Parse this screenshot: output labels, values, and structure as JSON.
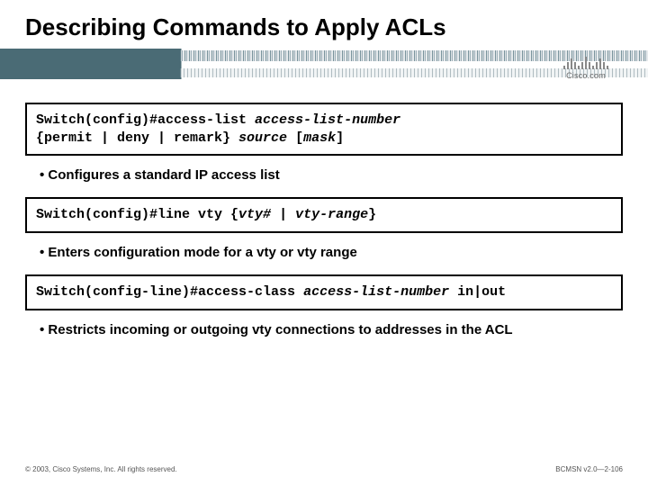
{
  "title": "Describing Commands to Apply ACLs",
  "logo_text": "Cisco.com",
  "sections": [
    {
      "cmd_plain1": "Switch(config)#access-list ",
      "cmd_italic1": "access-list-number",
      "cmd_plain2": "\n{permit | deny | remark} ",
      "cmd_italic2": "source",
      "cmd_plain3": " [",
      "cmd_italic3": "mask",
      "cmd_plain4": "]",
      "bullet": "Configures a standard IP access list"
    },
    {
      "cmd_plain1": "Switch(config)#line vty {",
      "cmd_italic1": "vty#",
      "cmd_plain2": " | ",
      "cmd_italic2": "vty-range",
      "cmd_plain3": "}",
      "cmd_italic3": "",
      "cmd_plain4": "",
      "bullet": "Enters configuration mode for a vty or vty range"
    },
    {
      "cmd_plain1": "Switch(config-line)#access-class ",
      "cmd_italic1": "access-list-number",
      "cmd_plain2": " in|out",
      "cmd_italic2": "",
      "cmd_plain3": "",
      "cmd_italic3": "",
      "cmd_plain4": "",
      "bullet": "Restricts incoming or outgoing vty connections to addresses in the ACL"
    }
  ],
  "footer_left": "© 2003, Cisco Systems, Inc. All rights reserved.",
  "footer_right": "BCMSN v2.0—2-106"
}
